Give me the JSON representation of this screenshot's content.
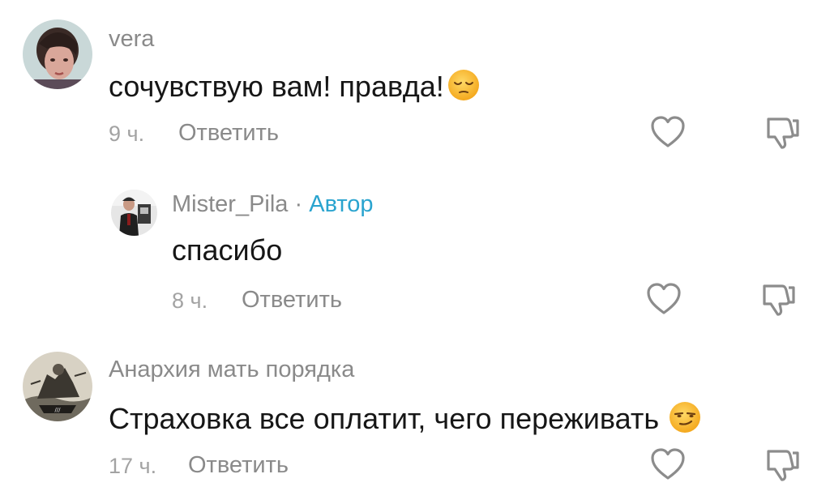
{
  "comments": [
    {
      "username": "vera",
      "text": "сочувствую вам! правда!",
      "emoji_icon": "pensive-face-icon",
      "time": "9 ч.",
      "reply_label": "Ответить"
    },
    {
      "username": "Mister_Pila",
      "separator": "·",
      "author_badge": "Автор",
      "text": "спасибо",
      "time": "8 ч.",
      "reply_label": "Ответить"
    },
    {
      "username": "Анархия мать порядка",
      "text": "Страховка все оплатит, чего переживать",
      "emoji_icon": "smirking-face-icon",
      "time": "17 ч.",
      "reply_label": "Ответить"
    }
  ],
  "colors": {
    "author_accent": "#2aa4cf",
    "secondary_text": "#8a8a8a",
    "time_text": "#a3a3a3",
    "primary_text": "#161616"
  },
  "icons": {
    "like": "heart-outline-icon",
    "dislike": "thumbs-down-outline-icon"
  }
}
